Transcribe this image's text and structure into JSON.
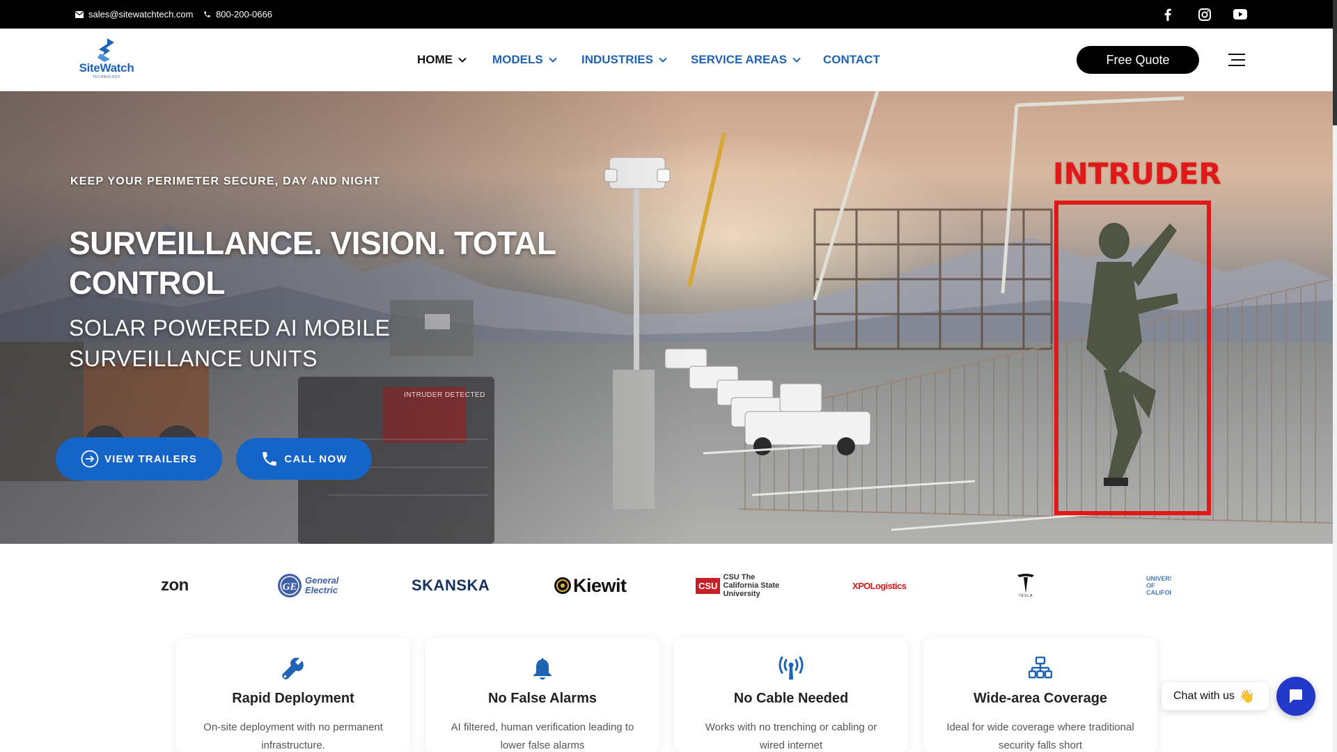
{
  "topbar": {
    "email": "sales@sitewatchtech.com",
    "phone": "800-200-0666",
    "social": [
      "facebook-icon",
      "instagram-icon",
      "youtube-icon"
    ]
  },
  "header": {
    "logo_text": "SiteWatch",
    "logo_sub": "TECHNOLOGY",
    "nav": [
      {
        "label": "HOME",
        "active": true,
        "dropdown": true
      },
      {
        "label": "MODELS",
        "active": false,
        "dropdown": true
      },
      {
        "label": "INDUSTRIES",
        "active": false,
        "dropdown": true
      },
      {
        "label": "SERVICE AREAS",
        "active": false,
        "dropdown": true
      },
      {
        "label": "CONTACT",
        "active": false,
        "dropdown": false
      }
    ],
    "quote_label": "Free Quote"
  },
  "hero": {
    "kicker": "KEEP YOUR PERIMETER SECURE, DAY AND NIGHT",
    "title": "SURVEILLANCE. VISION. TOTAL CONTROL",
    "subtitle": "SOLAR POWERED AI MOBILE SURVEILLANCE UNITS",
    "btn_trailers": "VIEW TRAILERS",
    "btn_call": "CALL NOW",
    "intruder_label": "INTRUDER",
    "screen_label": "INTRUDER DETECTED"
  },
  "brands": [
    {
      "name": "zon"
    },
    {
      "name": "General Electric"
    },
    {
      "name": "SKANSKA"
    },
    {
      "name": "Kiewit"
    },
    {
      "name": "CSU The California State University"
    },
    {
      "name": "XPOLogistics"
    },
    {
      "name": "TESLA"
    },
    {
      "name": "UNIVERSITY OF CALIFORNIA"
    }
  ],
  "features": [
    {
      "icon": "wrench-icon",
      "title": "Rapid Deployment",
      "desc": "On-site deployment with no permanent infrastructure."
    },
    {
      "icon": "bell-icon",
      "title": "No False Alarms",
      "desc": "AI filtered, human verification leading to lower false alarms"
    },
    {
      "icon": "antenna-icon",
      "title": "No Cable Needed",
      "desc": "Works with no trenching or cabling or wired internet"
    },
    {
      "icon": "network-icon",
      "title": "Wide-area Coverage",
      "desc": "Ideal for wide coverage where traditional security falls short"
    }
  ],
  "chat": {
    "label": "Chat with us",
    "emoji": "👋"
  },
  "colors": {
    "brand_blue": "#1564c8",
    "nav_blue": "#1f63b4",
    "topbar": "#000000",
    "intruder_red": "#e01818",
    "chat_blue": "#2238c9"
  }
}
